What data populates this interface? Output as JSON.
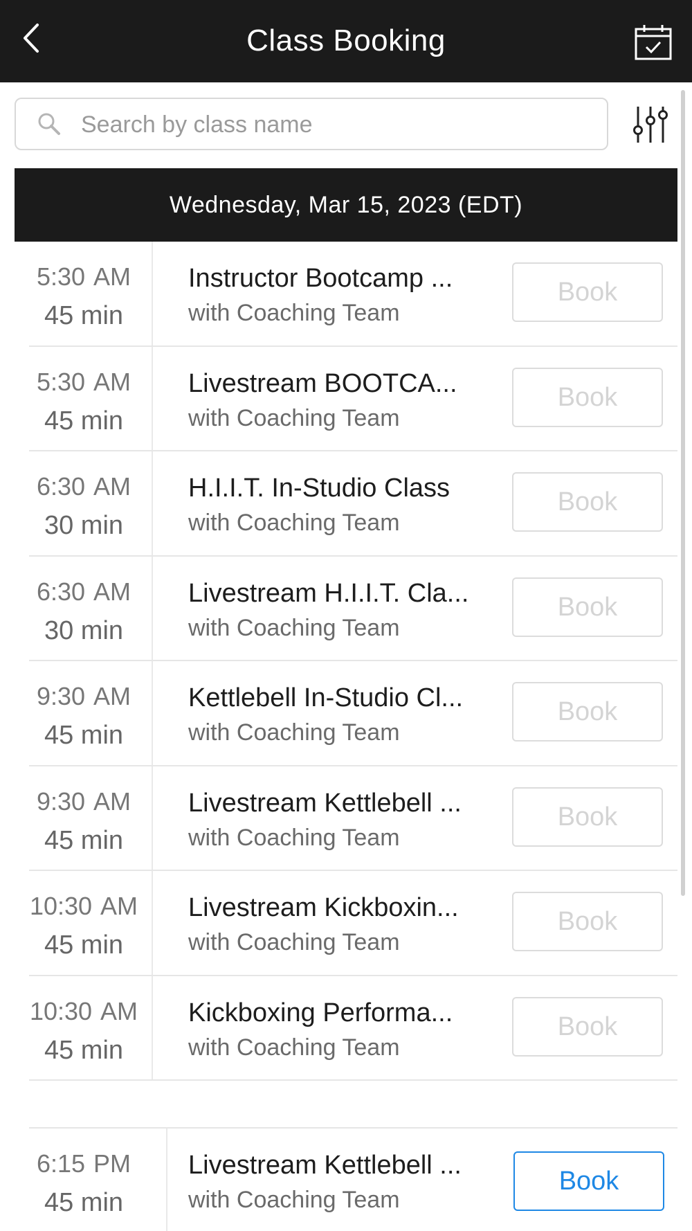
{
  "header": {
    "title": "Class Booking",
    "back_icon": "chevron-left-icon",
    "calendar_icon": "calendar-check-icon"
  },
  "search": {
    "placeholder": "Search by class name",
    "value": "",
    "search_icon": "search-icon",
    "filter_icon": "sliders-icon"
  },
  "date_header": "Wednesday, Mar 15, 2023 (EDT)",
  "colors": {
    "appbar": "#1b1b1b",
    "book_disabled": "#d4d4d4",
    "book_active": "#1e88e5"
  },
  "classes": [
    {
      "time": "5:30",
      "ampm": "AM",
      "duration": "45 min",
      "name": "Instructor Bootcamp ...",
      "coach": "with Coaching Team",
      "book_label": "Book",
      "enabled": false
    },
    {
      "time": "5:30",
      "ampm": "AM",
      "duration": "45 min",
      "name": "Livestream BOOTCA...",
      "coach": "with Coaching Team",
      "book_label": "Book",
      "enabled": false
    },
    {
      "time": "6:30",
      "ampm": "AM",
      "duration": "30 min",
      "name": "H.I.I.T. In-Studio Class",
      "coach": "with Coaching Team",
      "book_label": "Book",
      "enabled": false
    },
    {
      "time": "6:30",
      "ampm": "AM",
      "duration": "30 min",
      "name": "Livestream H.I.I.T. Cla...",
      "coach": "with Coaching Team",
      "book_label": "Book",
      "enabled": false
    },
    {
      "time": "9:30",
      "ampm": "AM",
      "duration": "45 min",
      "name": "Kettlebell In-Studio Cl...",
      "coach": "with Coaching Team",
      "book_label": "Book",
      "enabled": false
    },
    {
      "time": "9:30",
      "ampm": "AM",
      "duration": "45 min",
      "name": "Livestream Kettlebell ...",
      "coach": "with Coaching Team",
      "book_label": "Book",
      "enabled": false
    },
    {
      "time": "10:30",
      "ampm": "AM",
      "duration": "45 min",
      "name": "Livestream Kickboxin...",
      "coach": "with Coaching Team",
      "book_label": "Book",
      "enabled": false
    },
    {
      "time": "10:30",
      "ampm": "AM",
      "duration": "45 min",
      "name": "Kickboxing Performa...",
      "coach": "with Coaching Team",
      "book_label": "Book",
      "enabled": false
    }
  ],
  "pm_class": {
    "time": "6:15",
    "ampm": "PM",
    "duration": "45 min",
    "name": "Livestream Kettlebell ...",
    "coach": "with Coaching Team",
    "book_label": "Book",
    "enabled": true
  }
}
